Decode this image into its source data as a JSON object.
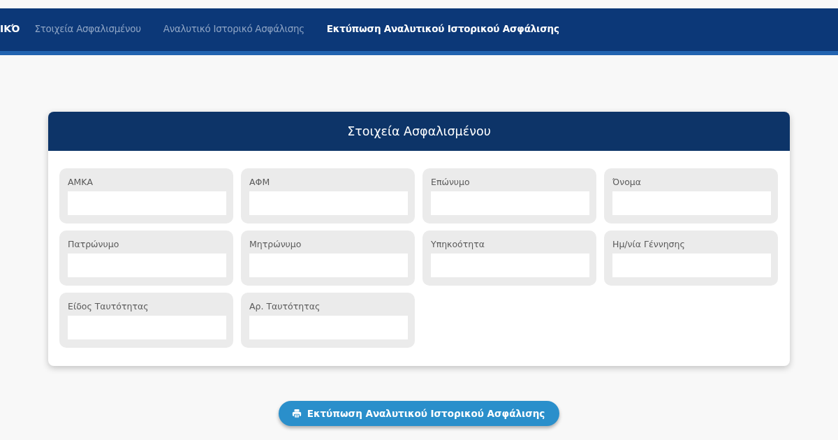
{
  "nav": {
    "brand": "ΙΚΌ",
    "tabs": [
      {
        "label": "Στοιχεία Ασφαλισμένου",
        "selected": false
      },
      {
        "label": "Αναλυτικό Ιστορικό Ασφάλισης",
        "selected": false
      },
      {
        "label": "Εκτύπωση Αναλυτικού Ιστορικού Ασφάλισης",
        "selected": true
      }
    ]
  },
  "card": {
    "title": "Στοιχεία Ασφαλισμένου",
    "fields": [
      {
        "label": "ΑΜΚΑ"
      },
      {
        "label": "ΑΦΜ"
      },
      {
        "label": "Επώνυμο"
      },
      {
        "label": "Όνομα"
      },
      {
        "label": "Πατρώνυμο"
      },
      {
        "label": "Μητρώνυμο"
      },
      {
        "label": "Υπηκοότητα"
      },
      {
        "label": "Ημ/νία Γέννησης"
      },
      {
        "label": "Είδος Ταυτότητας"
      },
      {
        "label": "Αρ. Ταυτότητας"
      }
    ]
  },
  "print_button": {
    "label": "Εκτύπωση Αναλυτικού Ιστορικού Ασφάλισης"
  }
}
